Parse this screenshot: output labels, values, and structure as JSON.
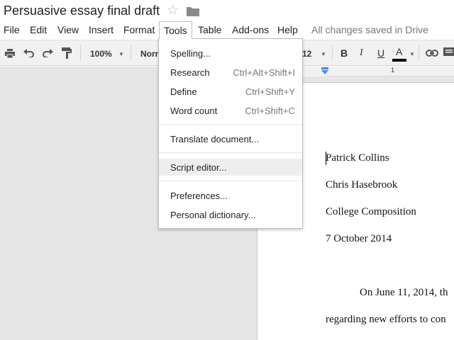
{
  "title_bar": {
    "document_title": "Persuasive essay final draft",
    "icons": [
      "star-icon",
      "folder-icon"
    ]
  },
  "menu_bar": {
    "items": [
      "File",
      "Edit",
      "View",
      "Insert",
      "Format",
      "Tools",
      "Table",
      "Add-ons",
      "Help"
    ],
    "open_menu": "Tools",
    "save_status": "All changes saved in Drive"
  },
  "toolbar": {
    "zoom": "100%",
    "style": "Normal text",
    "font_size": "12",
    "bold": "B",
    "italic": "I",
    "underline": "U",
    "text_color": "A",
    "text_color_hex": "#000000"
  },
  "ruler": {
    "number": "1"
  },
  "tools_menu": {
    "items": [
      {
        "label": "Spelling...",
        "shortcut": ""
      },
      {
        "label": "Research",
        "shortcut": "Ctrl+Alt+Shift+I"
      },
      {
        "label": "Define",
        "shortcut": "Ctrl+Shift+Y"
      },
      {
        "label": "Word count",
        "shortcut": "Ctrl+Shift+C"
      },
      {
        "label": "Translate document...",
        "shortcut": ""
      },
      {
        "label": "Script editor...",
        "shortcut": "",
        "highlighted": true
      },
      {
        "label": "Preferences...",
        "shortcut": ""
      },
      {
        "label": "Personal dictionary...",
        "shortcut": ""
      }
    ]
  },
  "document": {
    "heading_lines": [
      "Patrick Collins",
      "Chris Hasebrook",
      "College Composition",
      "7 October 2014"
    ],
    "body_lines": [
      "On June 11, 2014, th",
      "regarding new efforts to con"
    ]
  }
}
